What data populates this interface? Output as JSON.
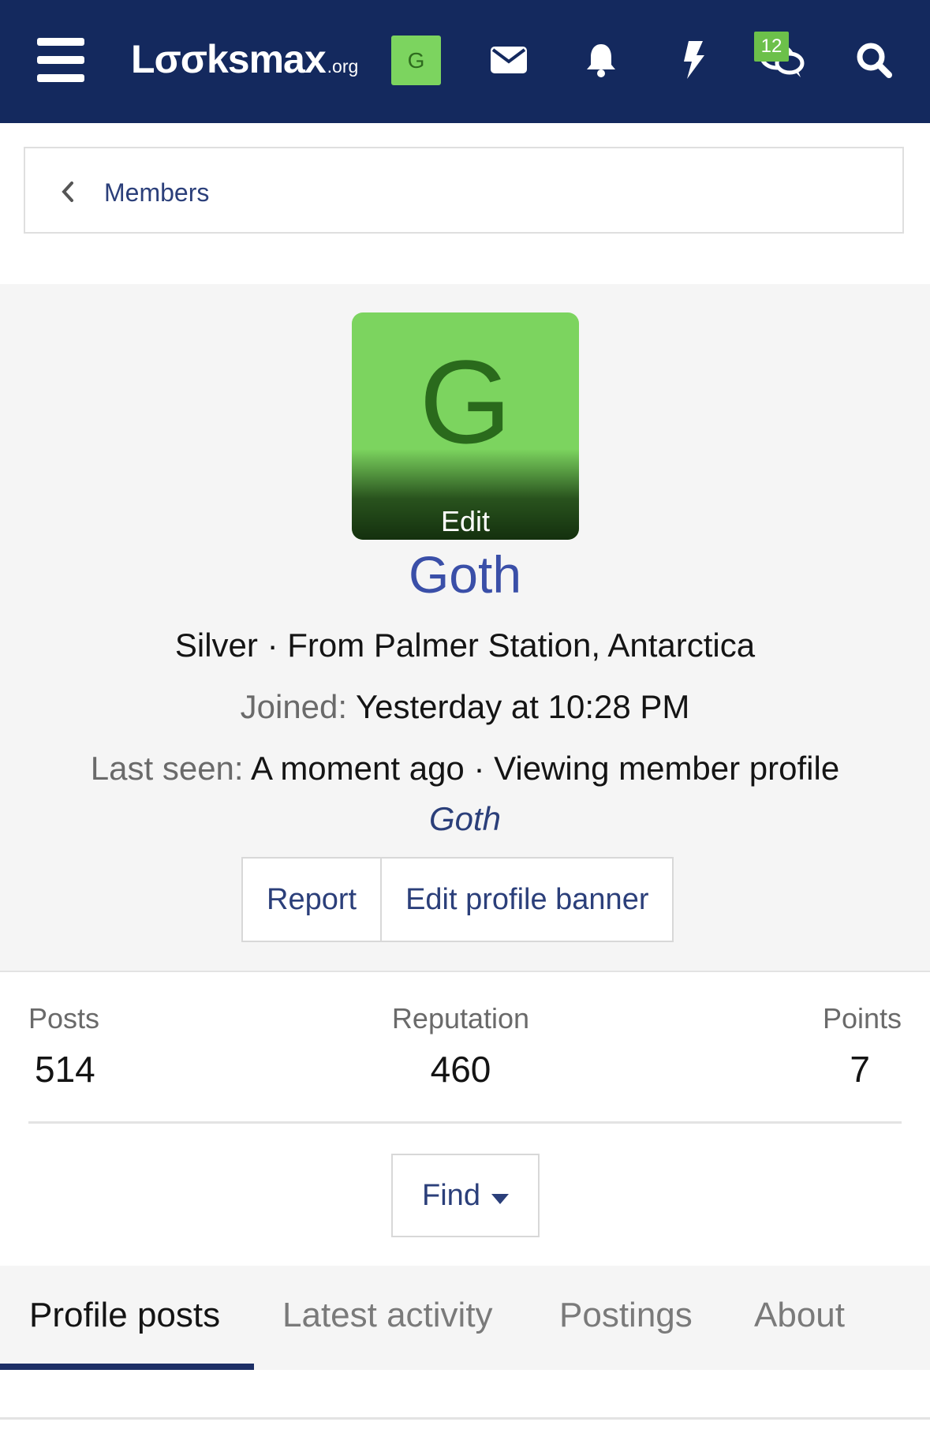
{
  "header": {
    "logo_main": "Lσσksmax",
    "logo_tld": ".org",
    "avatar_letter": "G",
    "notification_badge": "12",
    "icons": [
      "menu-icon",
      "mail-icon",
      "bell-icon",
      "bolt-icon",
      "chat-icon",
      "search-icon"
    ]
  },
  "breadcrumb": {
    "label": "Members"
  },
  "profile": {
    "avatar_letter": "G",
    "avatar_edit": "Edit",
    "username": "Goth",
    "rank_location": "Silver · From Palmer Station, Antarctica",
    "joined_label": "Joined:",
    "joined_value": "Yesterday at 10:28 PM",
    "last_seen_label": "Last seen:",
    "last_seen_value": "A moment ago · Viewing member profile",
    "viewing_name": "Goth",
    "buttons": {
      "report": "Report",
      "edit_banner": "Edit profile banner"
    }
  },
  "stats": {
    "posts_label": "Posts",
    "posts_value": "514",
    "reputation_label": "Reputation",
    "reputation_value": "460",
    "points_label": "Points",
    "points_value": "7"
  },
  "find": {
    "label": "Find"
  },
  "tabs": [
    {
      "label": "Profile posts",
      "active": true
    },
    {
      "label": "Latest activity",
      "active": false
    },
    {
      "label": "Postings",
      "active": false
    },
    {
      "label": "About",
      "active": false
    }
  ],
  "colors": {
    "nav_bg": "#14295e",
    "avatar_green": "#7cd45f",
    "link_blue": "#2b3f7a",
    "username_blue": "#3a4fa8",
    "badge_green": "#6cc04a"
  }
}
